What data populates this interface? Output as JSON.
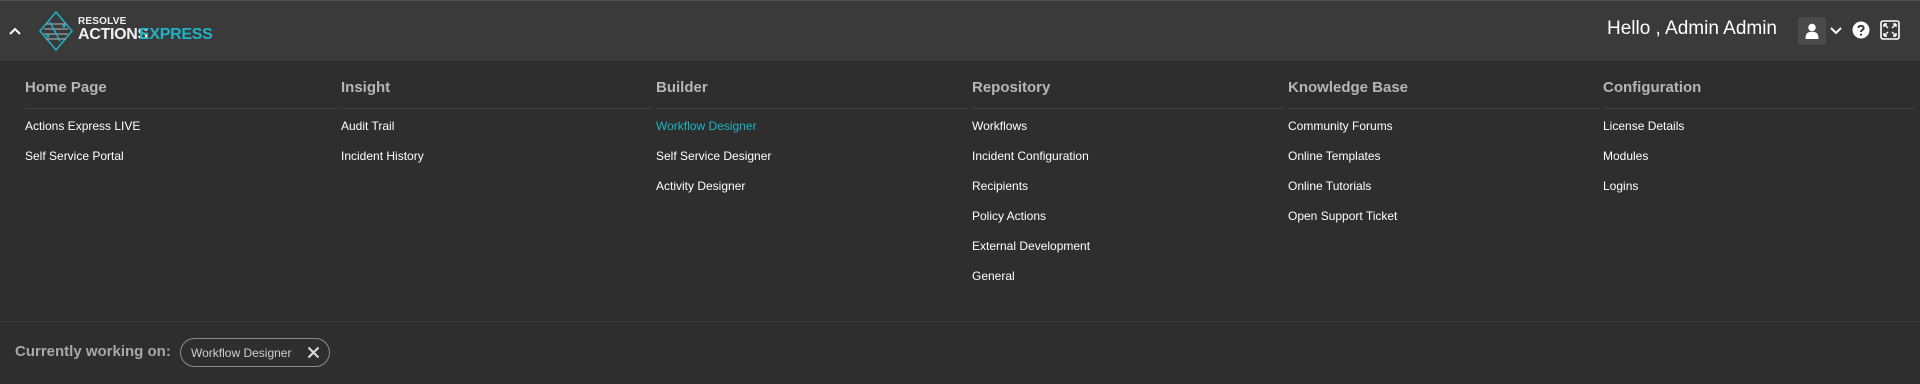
{
  "header": {
    "logo": {
      "line1": "RESOLVE",
      "line2a": "ACTIONS",
      "line2b": "EXPRESS"
    },
    "greeting": "Hello , Admin Admin",
    "icons": {
      "collapse": "chevron-up-icon",
      "user": "user-icon",
      "user_menu": "chevron-down-icon",
      "help": "help-circle-icon",
      "fullscreen": "expand-icon"
    }
  },
  "menu": {
    "columns": [
      {
        "title": "Home Page",
        "items": [
          "Actions Express LIVE",
          "Self Service Portal"
        ]
      },
      {
        "title": "Insight",
        "items": [
          "Audit Trail",
          "Incident History"
        ]
      },
      {
        "title": "Builder",
        "items": [
          "Workflow Designer",
          "Self Service Designer",
          "Activity Designer"
        ],
        "active": "Workflow Designer"
      },
      {
        "title": "Repository",
        "items": [
          "Workflows",
          "Incident Configuration",
          "Recipients",
          "Policy Actions",
          "External Development",
          "General"
        ]
      },
      {
        "title": "Knowledge Base",
        "items": [
          "Community Forums",
          "Online Templates",
          "Online Tutorials",
          "Open Support Ticket"
        ]
      },
      {
        "title": "Configuration",
        "items": [
          "License Details",
          "Modules",
          "Logins"
        ]
      }
    ]
  },
  "footer": {
    "working_label": "Currently working on:",
    "chip_label": "Workflow Designer"
  },
  "colors": {
    "accent": "#1fb4c4",
    "bg": "#2e2e2e",
    "topbar": "#3a3a3a"
  }
}
